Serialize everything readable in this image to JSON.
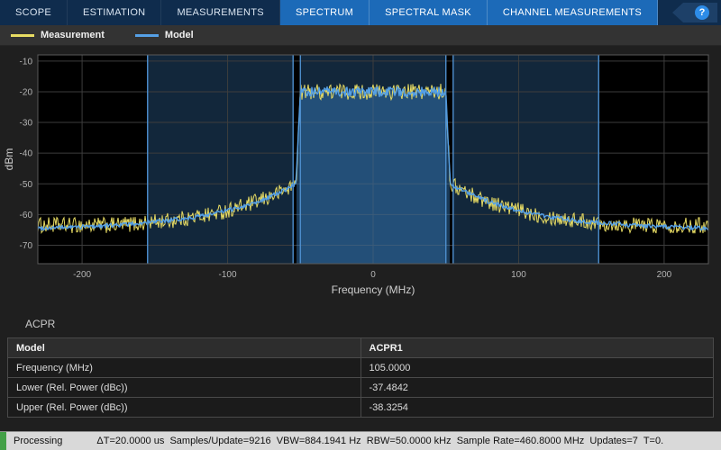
{
  "toolbar": {
    "tabs": [
      {
        "label": "SCOPE",
        "selected": false
      },
      {
        "label": "ESTIMATION",
        "selected": false
      },
      {
        "label": "MEASUREMENTS",
        "selected": false
      },
      {
        "label": "SPECTRUM",
        "selected": true
      },
      {
        "label": "SPECTRAL MASK",
        "selected": true
      },
      {
        "label": "CHANNEL MEASUREMENTS",
        "selected": true
      }
    ],
    "help_label": "?"
  },
  "legend": {
    "items": [
      {
        "label": "Measurement",
        "color": "#e8dc63"
      },
      {
        "label": "Model",
        "color": "#55a0e6"
      }
    ]
  },
  "chart_data": {
    "type": "line",
    "title": "",
    "xlabel": "Frequency (MHz)",
    "ylabel": "dBm",
    "xlim": [
      -230.4,
      230.4
    ],
    "ylim": [
      -76,
      -8
    ],
    "x_ticks": [
      -200,
      -100,
      0,
      100,
      200
    ],
    "y_ticks": [
      -10,
      -20,
      -30,
      -40,
      -50,
      -60,
      -70
    ],
    "grid": true,
    "legend_position": "top-left",
    "series": [
      {
        "name": "Measurement",
        "color": "#e8dc63",
        "noise_db": 2.6
      },
      {
        "name": "Model",
        "color": "#55a0e6",
        "noise_db": 1.6
      }
    ],
    "shape": {
      "plateau_dbm": -20,
      "band_edge_mhz": 50,
      "edge_bottom_mhz": 53,
      "edge_level_dbm": -50,
      "floor_dbm": -65,
      "floor_meas_dbm": -63.5,
      "skirt_decay_mhz": 55,
      "skirt_amp_db": 15
    },
    "regions": [
      {
        "name": "lower-adjacent-channel",
        "x0": -155,
        "x1": -55
      },
      {
        "name": "main-channel",
        "x0": -50,
        "x1": 50
      },
      {
        "name": "upper-adjacent-channel",
        "x0": 55,
        "x1": 155
      }
    ],
    "styles": {
      "plot_bg": "#000000",
      "grid": "#3d3d3d",
      "box_border": "#5a5a5a",
      "tick_color": "#b5b5b5",
      "axis_label_color": "#cfcfcf",
      "region_fill": "rgba(58,128,196,0.30)",
      "region_edge": "#4e8fce",
      "model_fill": "rgba(58,128,196,0.45)"
    }
  },
  "acpr": {
    "title": "ACPR",
    "table": {
      "headers": [
        "Model",
        "ACPR1"
      ],
      "rows": [
        {
          "label": "Frequency (MHz)",
          "value": "105.0000"
        },
        {
          "label": "Lower (Rel. Power (dBc))",
          "value": "-37.4842"
        },
        {
          "label": "Upper (Rel. Power (dBc))",
          "value": "-38.3254"
        }
      ]
    }
  },
  "status": {
    "state": "Processing",
    "info": "ΔT=20.0000 us  Samples/Update=9216  VBW=884.1941 Hz  RBW=50.0000 kHz  Sample Rate=460.8000 MHz  Updates=7  T=0."
  }
}
